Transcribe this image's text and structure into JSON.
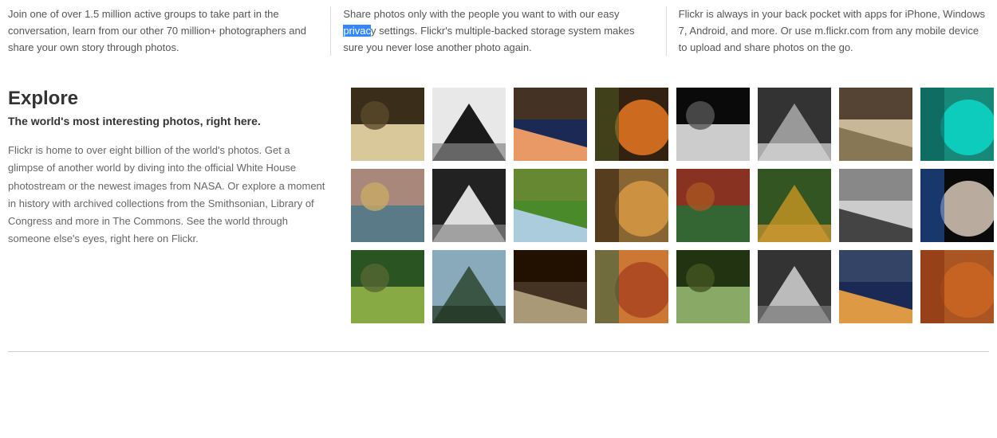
{
  "top_columns": {
    "col1": "Join one of over 1.5 million active groups to take part in the conversation, learn from our other 70 million+ photographers and share your own story through photos.",
    "col2_pre": "Share photos only with the people you want to with our easy ",
    "col2_highlight": "privac",
    "col2_post": "y settings. Flickr's multiple-backed storage system makes sure you never lose another photo again.",
    "col3": "Flickr is always in your back pocket with apps for iPhone, Windows 7, Android, and more. Or use m.flickr.com from any mobile device to upload and share photos on the go."
  },
  "explore": {
    "heading": "Explore",
    "subtitle": "The world's most interesting photos, right here.",
    "body": "Flickr is home to over eight billion of the world's photos. Get a glimpse of another world by diving into the official White House photostream or the newest images from NASA. Or explore a moment in history with archived collections from the Smithsonian, Library of Congress and more in The Commons. See the world through someone else's eyes, right here on Flickr."
  },
  "thumbnails": [
    {
      "name": "dancer-sepia",
      "colors": [
        "#3a2e1a",
        "#d8c89a",
        "#5a4a2a"
      ]
    },
    {
      "name": "wedding-bw",
      "colors": [
        "#1a1a1a",
        "#e8e8e8",
        "#888888"
      ]
    },
    {
      "name": "bridge-sunset",
      "colors": [
        "#1a2a55",
        "#e89966",
        "#443325"
      ]
    },
    {
      "name": "field-sunset",
      "colors": [
        "#e87722",
        "#4a5522",
        "#332211"
      ]
    },
    {
      "name": "ring-bw",
      "colors": [
        "#0a0a0a",
        "#cccccc",
        "#555555"
      ]
    },
    {
      "name": "rocks-bw",
      "colors": [
        "#999999",
        "#333333",
        "#dddddd"
      ]
    },
    {
      "name": "building-tan",
      "colors": [
        "#c8b898",
        "#887755",
        "#554433"
      ]
    },
    {
      "name": "underwater-teal",
      "colors": [
        "#0dd8c8",
        "#0a5a55",
        "#188878"
      ]
    },
    {
      "name": "riverside-buildings",
      "colors": [
        "#a8887a",
        "#5a7a88",
        "#c8aa66"
      ]
    },
    {
      "name": "boats-bw",
      "colors": [
        "#dddddd",
        "#222222",
        "#888888"
      ]
    },
    {
      "name": "green-field-clouds",
      "colors": [
        "#4a8a2a",
        "#aaccdd",
        "#668833"
      ]
    },
    {
      "name": "palm-sunset",
      "colors": [
        "#d89944",
        "#332211",
        "#886633"
      ]
    },
    {
      "name": "autumn-hill",
      "colors": [
        "#883322",
        "#336633",
        "#aa5522"
      ]
    },
    {
      "name": "vineyard-aerial",
      "colors": [
        "#aa8822",
        "#335522",
        "#cc9933"
      ]
    },
    {
      "name": "vintage-group-bw",
      "colors": [
        "#cccccc",
        "#444444",
        "#888888"
      ]
    },
    {
      "name": "blue-eye",
      "colors": [
        "#d8c8b8",
        "#2255aa",
        "#0a0a0a"
      ]
    },
    {
      "name": "forest-path",
      "colors": [
        "#2a5522",
        "#88aa44",
        "#556633"
      ]
    },
    {
      "name": "lake-mountains",
      "colors": [
        "#3a5544",
        "#88aabb",
        "#223322"
      ]
    },
    {
      "name": "pier-underside",
      "colors": [
        "#443322",
        "#aa9977",
        "#221100"
      ]
    },
    {
      "name": "autumn-valley",
      "colors": [
        "#aa4422",
        "#336644",
        "#cc7733"
      ]
    },
    {
      "name": "pine-forest",
      "colors": [
        "#223311",
        "#88aa66",
        "#445522"
      ]
    },
    {
      "name": "street-crowd-bw",
      "colors": [
        "#bbbbbb",
        "#333333",
        "#777777"
      ]
    },
    {
      "name": "skyline-dusk",
      "colors": [
        "#1a2a55",
        "#dd9944",
        "#334466"
      ]
    },
    {
      "name": "autumn-trees-orange",
      "colors": [
        "#cc6622",
        "#883311",
        "#aa5522"
      ]
    }
  ]
}
